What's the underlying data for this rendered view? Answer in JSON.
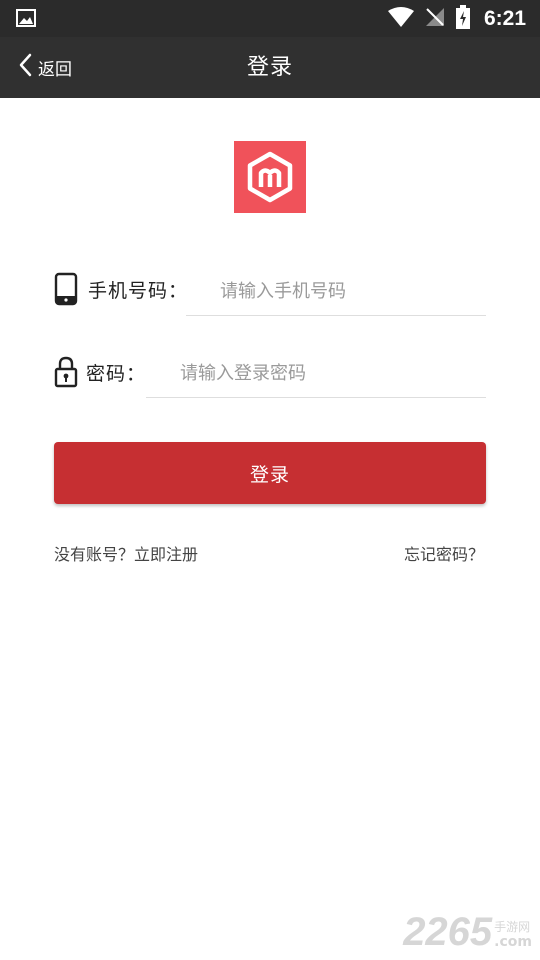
{
  "status_bar": {
    "time": "6:21"
  },
  "header": {
    "back_label": "返回",
    "title": "登录"
  },
  "form": {
    "phone_label": "手机号码：",
    "phone_placeholder": "请输入手机号码",
    "phone_value": "",
    "password_label": "密码：",
    "password_placeholder": "请输入登录密码",
    "password_value": ""
  },
  "login_button": {
    "label": "登录"
  },
  "links": {
    "register": "没有账号？立即注册",
    "forgot": "忘记密码？"
  },
  "watermark": {
    "number": "2265",
    "site_cn": "手游网",
    "domain": ".com"
  },
  "colors": {
    "status_bar": "#2b2b2b",
    "top_bar": "#303030",
    "logo_bg": "#f0525a",
    "button": "#c62f32"
  },
  "icons": {
    "status_left": "gallery-icon",
    "status_right": [
      "wifi-icon",
      "no-signal-icon",
      "battery-charging-icon"
    ],
    "back": "chevron-left-icon",
    "phone": "phone-icon",
    "password": "lock-icon"
  }
}
